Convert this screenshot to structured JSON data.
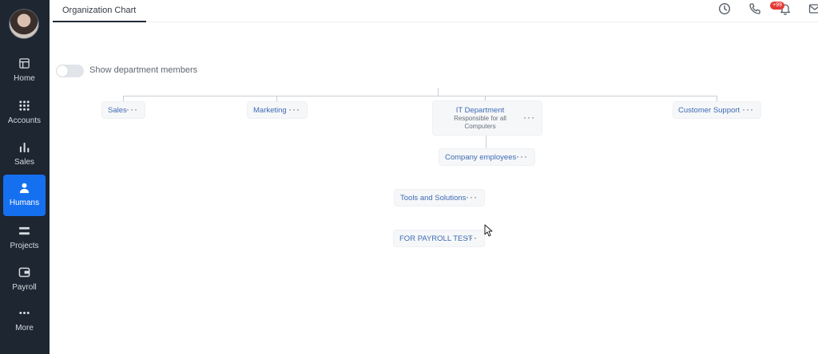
{
  "sidebar": {
    "items": [
      {
        "label": "Home",
        "icon": "layout-icon"
      },
      {
        "label": "Accounts",
        "icon": "grid-icon"
      },
      {
        "label": "Sales",
        "icon": "bar-chart-icon"
      },
      {
        "label": "Humans",
        "icon": "user-icon",
        "active": true
      },
      {
        "label": "Projects",
        "icon": "list-icon"
      },
      {
        "label": "Payroll",
        "icon": "wallet-icon"
      },
      {
        "label": "More",
        "icon": "ellipsis-icon"
      }
    ]
  },
  "header": {
    "tab_label": "Organization Chart",
    "notification_badge": "+99"
  },
  "controls": {
    "toggle_label": "Show department members",
    "toggle_on": false
  },
  "org": {
    "departments": [
      {
        "name": "Sales"
      },
      {
        "name": "Marketing"
      },
      {
        "name": "IT Department",
        "description": "Responsible for all Computers"
      },
      {
        "name": "Customer Support"
      }
    ],
    "it_children": [
      {
        "name": "Company employees"
      },
      {
        "name": "Tools and Solutions"
      },
      {
        "name": "FOR PAYROLL TEST"
      }
    ],
    "menu_glyph": "···"
  },
  "colors": {
    "sidebar_bg": "#1d2631",
    "active_accent": "#1570ef",
    "badge_red": "#e53935",
    "node_text": "#3d6bb3"
  }
}
